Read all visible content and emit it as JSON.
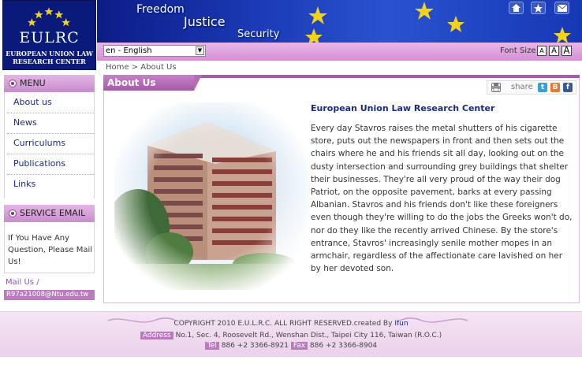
{
  "logo": {
    "abbr": "EULRC",
    "full_name_line1": "EUROPEAN UNION LAW",
    "full_name_line2": "RESEARCH CENTER"
  },
  "banner": {
    "words": [
      "Freedom",
      "Justice",
      "Security"
    ],
    "icons": [
      "home-icon",
      "star-icon",
      "mail-icon"
    ]
  },
  "langbar": {
    "language_selected": "en - English",
    "font_size_label": "Font Size",
    "font_buttons": [
      "A",
      "A",
      "A"
    ]
  },
  "breadcrumb": {
    "home": "Home",
    "separator": ">",
    "current": "About Us"
  },
  "sidebar": {
    "menu_title": "MENU",
    "items": [
      {
        "label": "About us"
      },
      {
        "label": "News"
      },
      {
        "label": "Curriculums"
      },
      {
        "label": "Publications"
      },
      {
        "label": "Links"
      }
    ],
    "email_title": "SERVICE EMAIL",
    "email_prompt": "If You Have Any Question, Please Mail Us!",
    "mail_us": "Mail Us /",
    "email_address": "R97a21008@Ntu.edu.tw"
  },
  "main": {
    "page_title": "About Us",
    "share_label": "share",
    "article_title": "European Union Law Research Center",
    "article_body": "Every day Stavros raises the metal shutters of his cigarette store, puts out the newspapers in front and then sets out the chairs where he and his friends sit all day, looking out on the dusty intersection and surrounding grey buildings that shelter their businesses. They're all very proud of the way their dog Patriot, on the opposite pavement, barks at every passing Albanian. Stavros and his friends don't like these foreigners even though they're willing to do the jobs the Greeks won't do, nor do they like the recently arrived Chinese. By the store's entrance, Stavros' increasingly senile mother mopes in an armchair, regardless of the affectionate care lavished on her by her devoted son."
  },
  "footer": {
    "copyright": "COPYRIGHT 2010 E.U.L.R.C. ALL RIGHT RESERVED.created By",
    "author": "Ifun",
    "address_label": "Address",
    "address": "No.1, Sec. 4, Roosevelt Rd., Wenshan Dist., Taipei City 116, Taiwan (R.O.C.)",
    "tel_label": "Tel",
    "tel": "886 +2 3366-8921",
    "fax_label": "Fax",
    "fax": "886 +2 3366-8904"
  },
  "colors": {
    "accent_purple": "#a85ca8",
    "banner_blue": "#1c3cb8",
    "link_blue": "#1a2a88"
  }
}
